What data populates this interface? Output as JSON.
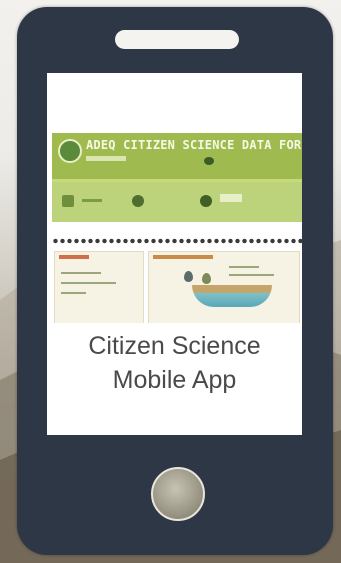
{
  "card": {
    "caption_line1": "Citizen Science",
    "caption_line2": "Mobile App",
    "thumbnail_heading": "ADEQ CITIZEN SCIENCE DATA FOR"
  },
  "colors": {
    "phone_body": "#2d3746",
    "screen": "#ffffff",
    "banner_green": "#9fbb4f",
    "band_green": "#bcd27b",
    "caption_text": "#4a4a4a"
  },
  "icons": {
    "speaker": "phone-speaker-icon",
    "home_button": "home-button-icon",
    "banner_logo": "logo-icon"
  }
}
